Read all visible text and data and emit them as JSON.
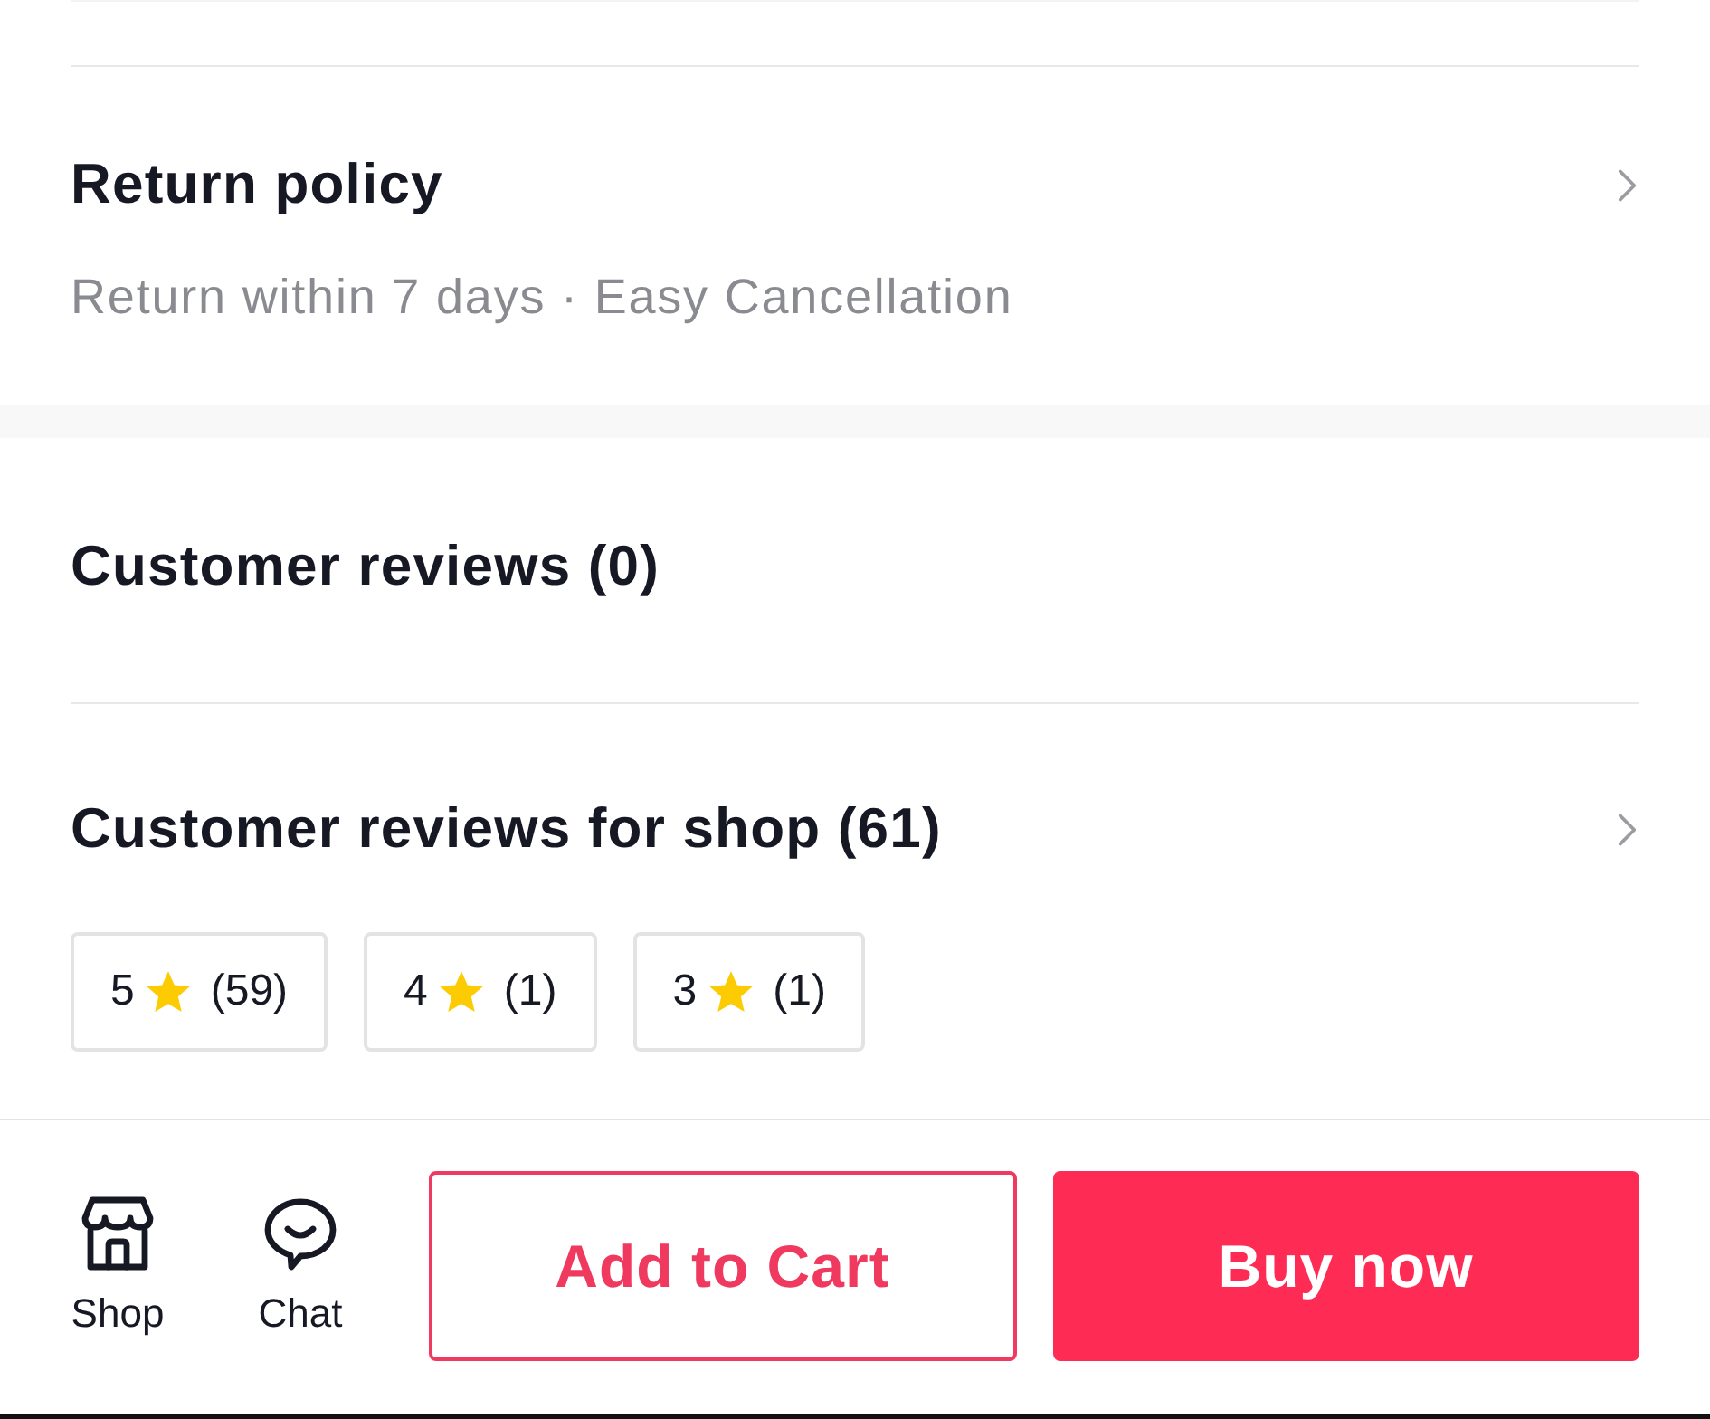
{
  "return_policy": {
    "title": "Return policy",
    "subtitle": "Return within 7 days · Easy Cancellation"
  },
  "product_reviews": {
    "title": "Customer reviews (0)"
  },
  "shop_reviews": {
    "title": "Customer reviews for shop (61)",
    "rating_filters": [
      {
        "rating": "5",
        "count": "(59)"
      },
      {
        "rating": "4",
        "count": "(1)"
      },
      {
        "rating": "3",
        "count": "(1)"
      }
    ]
  },
  "bottom_bar": {
    "actions": [
      {
        "kind": "shop",
        "label": "Shop"
      },
      {
        "kind": "chat",
        "label": "Chat"
      }
    ],
    "buttons": [
      {
        "kind": "outline",
        "label": "Add to Cart"
      },
      {
        "kind": "filled",
        "label": "Buy now"
      }
    ]
  }
}
